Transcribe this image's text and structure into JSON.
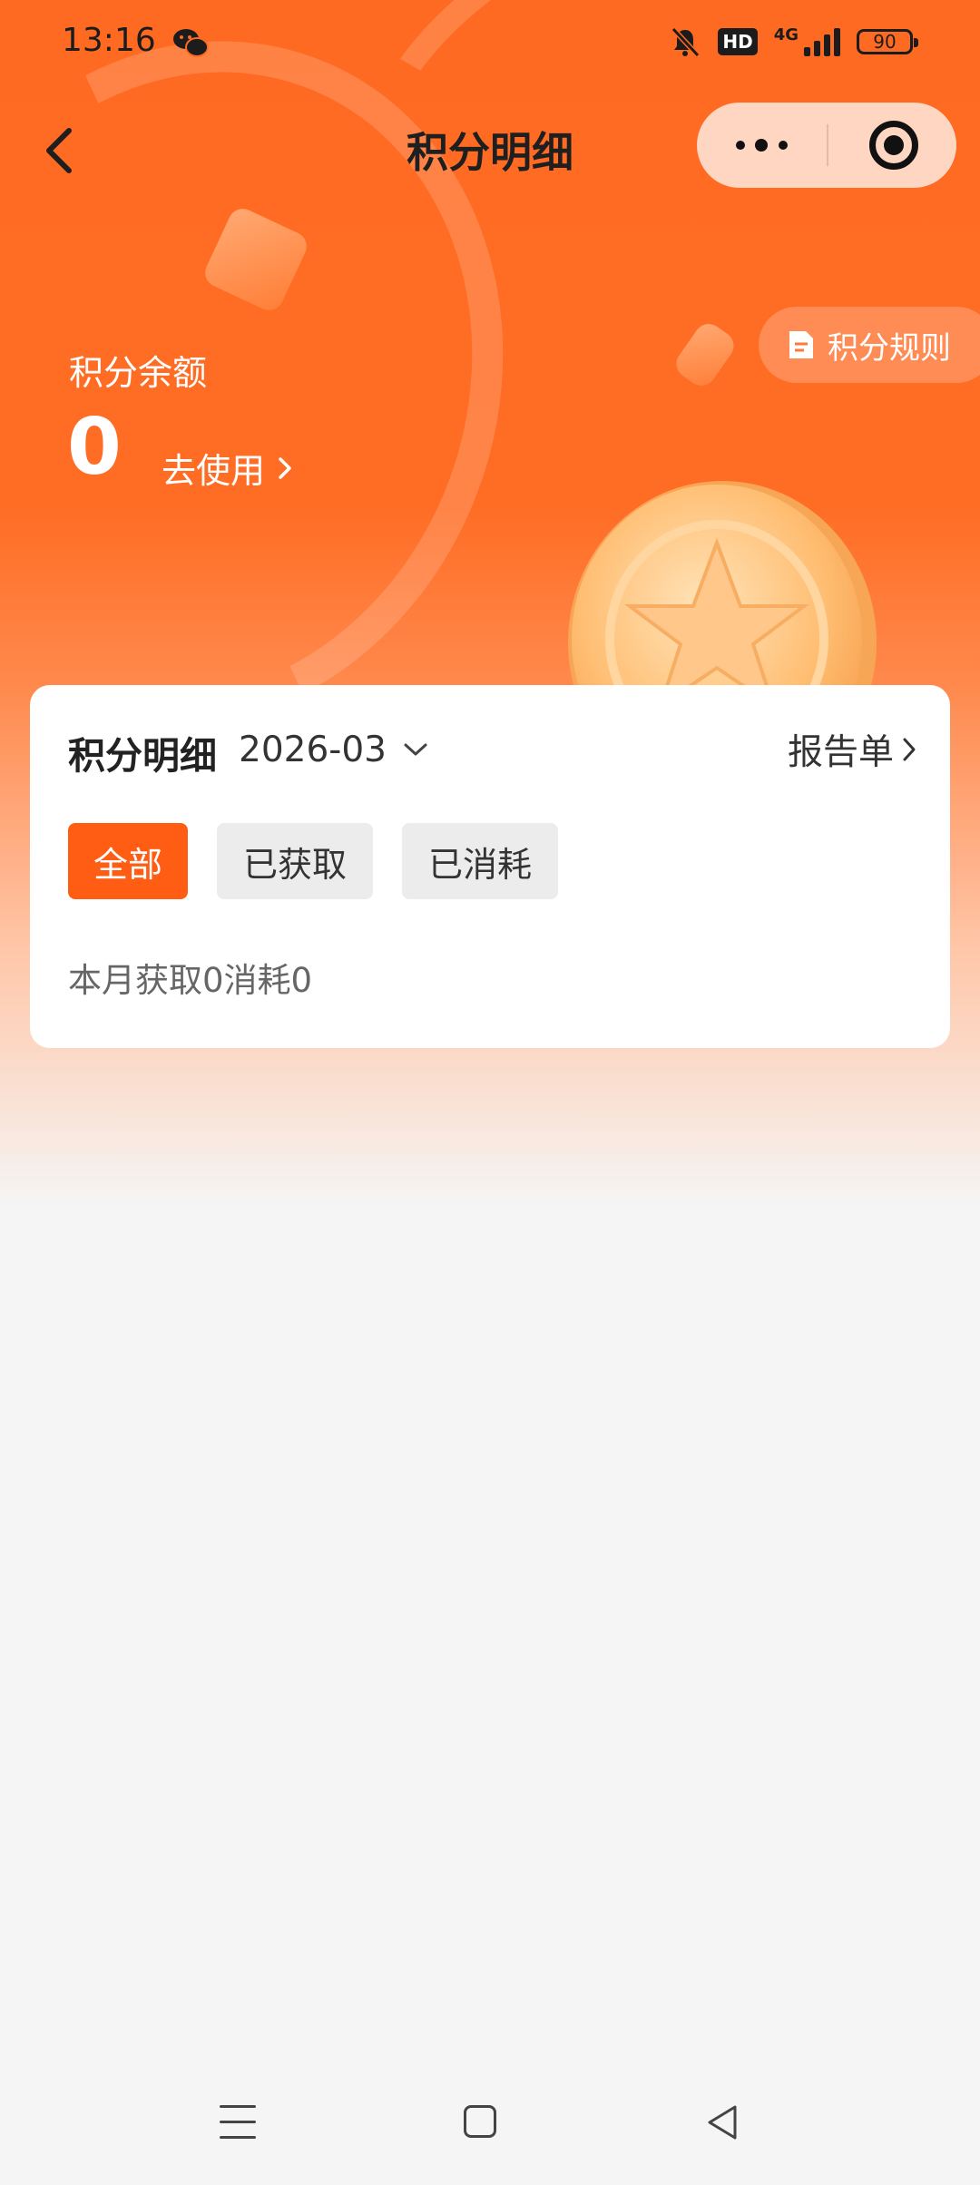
{
  "status_bar": {
    "time": "13:16",
    "hd": "HD",
    "network": "4G",
    "battery": "90",
    "icons": [
      "wechat-icon",
      "mute-bell-icon",
      "hd-icon",
      "signal-icon",
      "battery-icon"
    ]
  },
  "nav": {
    "title": "积分明细",
    "back_icon": "chevron-left-icon",
    "more_icon": "more-dots-icon",
    "close_icon": "target-close-icon"
  },
  "header": {
    "rules_label": "积分规则",
    "balance_label": "积分余额",
    "balance_value": "0",
    "use_label": "去使用"
  },
  "card": {
    "title": "积分明细",
    "month": "2026-03",
    "report_label": "报告单",
    "tabs": [
      {
        "label": "全部",
        "active": true
      },
      {
        "label": "已获取",
        "active": false
      },
      {
        "label": "已消耗",
        "active": false
      }
    ],
    "summary": "本月获取0消耗0"
  },
  "colors": {
    "accent": "#ff5c14",
    "header_bg": "#ff6a22",
    "page_bg": "#f5f5f5"
  }
}
